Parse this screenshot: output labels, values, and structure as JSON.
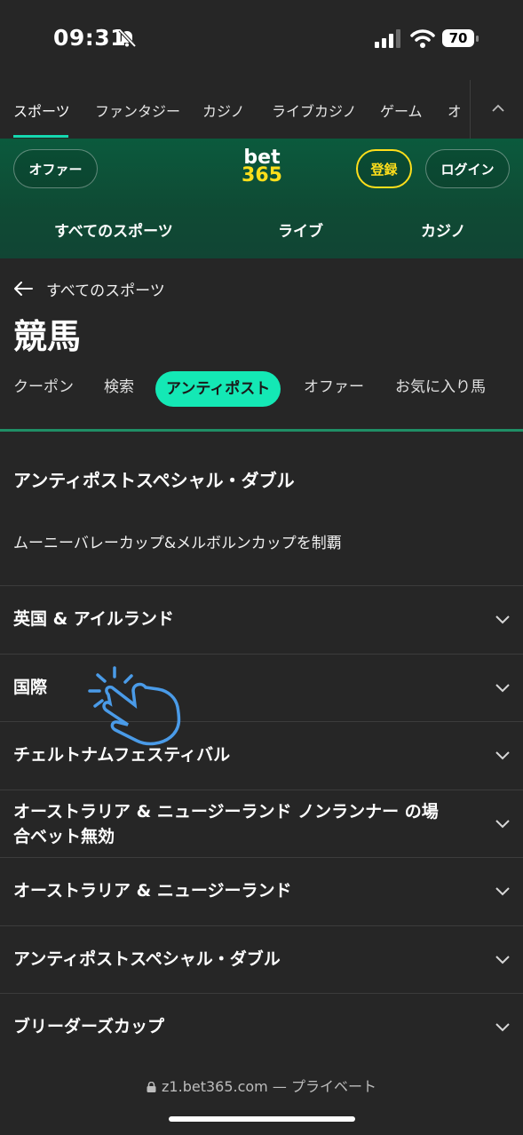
{
  "status_bar": {
    "time": "09:31",
    "battery": "70"
  },
  "top_tabs": [
    "スポーツ",
    "ファンタジー",
    "カジノ",
    "ライブカジノ",
    "ゲーム",
    "オ"
  ],
  "header": {
    "offer_label": "オファー",
    "logo_line1": "bet",
    "logo_line2": "365",
    "register_label": "登録",
    "login_label": "ログイン",
    "nav": [
      "すべてのスポーツ",
      "ライブ",
      "カジノ"
    ]
  },
  "breadcrumb": "すべてのスポーツ",
  "page_title": "競馬",
  "sub_tabs": [
    "クーポン",
    "検索",
    "アンティポスト",
    "オファー",
    "お気に入り馬"
  ],
  "featured": {
    "title": "アンティポストスペシャル・ダブル",
    "description": "ムーニーバレーカップ&メルボルンカップを制覇"
  },
  "sections": [
    "英国 & アイルランド",
    "国際",
    "チェルトナムフェスティバル",
    "オーストラリア & ニュージーランド ノンランナー の場合ベット無効",
    "オーストラリア & ニュージーランド",
    "アンティポストスペシャル・ダブル",
    "ブリーダーズカップ"
  ],
  "footer": {
    "domain": "z1.bet365.com",
    "suffix": "— プライベート"
  },
  "colors": {
    "accent": "#14e8b5",
    "brand_yellow": "#ffdf1b",
    "header_green": "#0b5a3d",
    "background": "#262626"
  }
}
